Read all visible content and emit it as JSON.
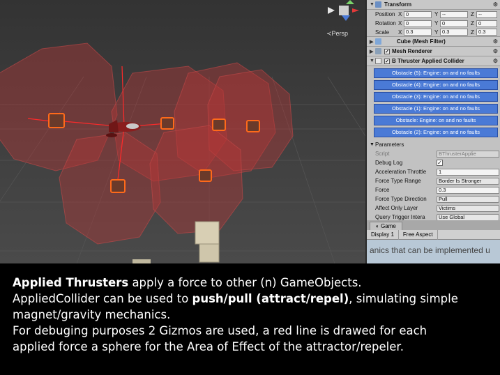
{
  "scene": {
    "gizmo_view": "Persp",
    "colors": {
      "background": "#3b3b3b",
      "sphere": "#a33a3a",
      "force_line": "#ff2a2a",
      "cube_outline": "#ff6a1a"
    }
  },
  "inspector": {
    "transform": {
      "title": "Transform",
      "position": {
        "label": "Position",
        "x": "0",
        "y": "--",
        "z": "--"
      },
      "rotation": {
        "label": "Rotation",
        "x": "0",
        "y": "0",
        "z": "0"
      },
      "scale": {
        "label": "Scale",
        "x": "0.3",
        "y": "0.3",
        "z": "0.3"
      }
    },
    "mesh_filter": {
      "title": "Cube (Mesh Filter)"
    },
    "mesh_renderer": {
      "title": "Mesh Renderer"
    },
    "applied_collider": {
      "title": "B Thruster Applied Collider",
      "obstacles": [
        "Obstacle (5): Engine: on and no faults",
        "Obstacle (4): Engine: on and no faults",
        "Obstacle (3): Engine: on and no faults",
        "Obstacle (1): Engine: on and no faults",
        "Obstacle: Engine: on and no faults",
        "Obstacle (2): Engine: on and no faults"
      ]
    },
    "parameters": {
      "title": "Parameters",
      "script_label": "Script",
      "script_value": "BThrusterApplie",
      "debug_log_label": "Debug Log",
      "debug_log_checked": true,
      "accel_label": "Acceleration Throttle",
      "accel_value": "1",
      "force_type_range_label": "Force Type Range",
      "force_type_range_value": "Border Is Stronger",
      "force_label": "Force",
      "force_value": "0.3",
      "force_dir_label": "Force Type Direction",
      "force_dir_value": "Pull",
      "affect_layer_label": "Affect Only Layer",
      "affect_layer_value": "Victims",
      "query_label": "Query Trigger Intera",
      "query_value": "Use Global"
    }
  },
  "game": {
    "tab_label": "Game",
    "display": "Display 1",
    "aspect": "Free Aspect",
    "view_text": "anics that can be implemented u"
  },
  "caption": {
    "l1_bold": "Applied Thrusters",
    "l1_rest": " apply a force to other (n) GameObjects.",
    "l2_a": "AppliedCollider can be used to ",
    "l2_bold": "push/pull (attract/repel)",
    "l2_c": ", simulating simple",
    "l3": "magnet/gravity mechanics.",
    "l4": "For debuging purposes 2 Gizmos are used, a red line is drawed for each",
    "l5": "applied force a sphere for the Area of Effect of the attractor/repeler."
  }
}
